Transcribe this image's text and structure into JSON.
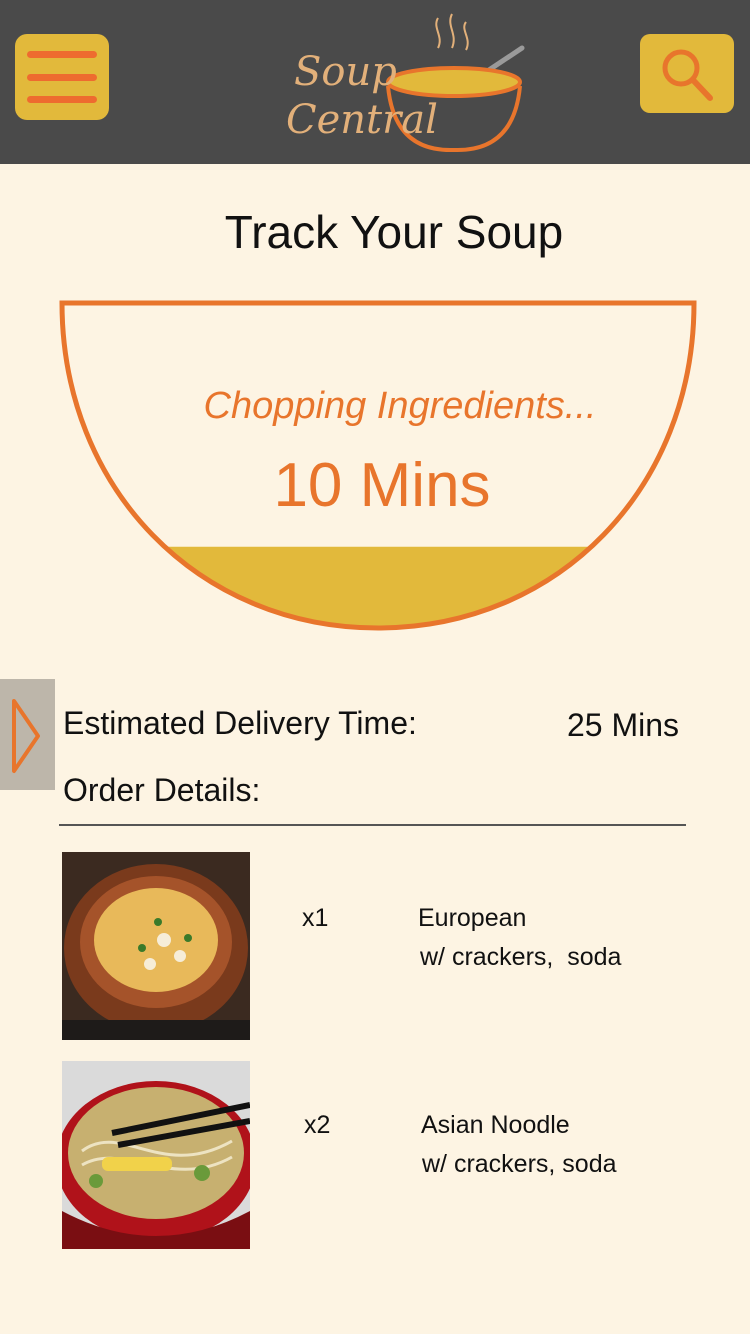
{
  "header": {
    "logo_line1": "Soup",
    "logo_line2": "Central",
    "menu_icon": "hamburger-menu-icon",
    "search_icon": "search-icon"
  },
  "tracker": {
    "title": "Track Your Soup",
    "status": "Chopping Ingredients...",
    "time_remaining": "10 Mins",
    "progress": 0.25
  },
  "delivery": {
    "label": "Estimated Delivery Time:",
    "value": "25 Mins"
  },
  "order": {
    "label": "Order Details:",
    "items": [
      {
        "qty": "x1",
        "name": "European",
        "extras": "w/ crackers,  soda"
      },
      {
        "qty": "x2",
        "name": "Asian Noodle",
        "extras": "w/ crackers, soda"
      }
    ]
  },
  "colors": {
    "header_bg": "#4A4A4A",
    "accent_yellow": "#E2B93B",
    "accent_orange": "#E8752C",
    "page_bg": "#FDF4E3"
  }
}
